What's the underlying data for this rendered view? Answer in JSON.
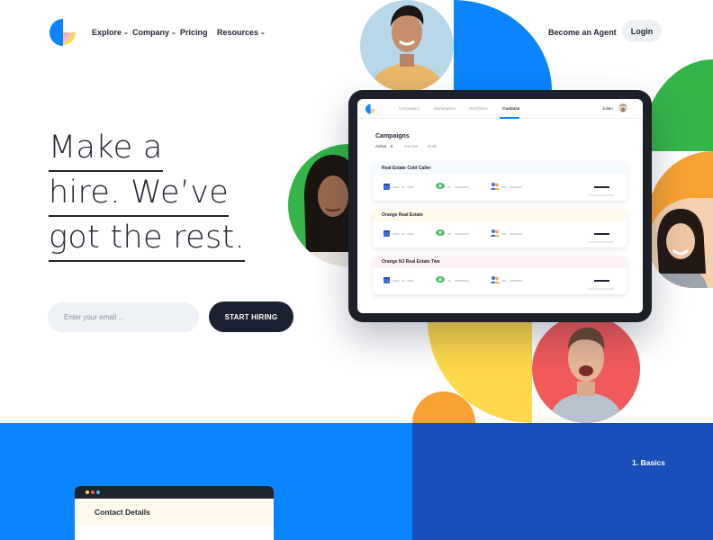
{
  "nav": {
    "items": [
      {
        "label": "Explore",
        "has_dropdown": true
      },
      {
        "label": "Company",
        "has_dropdown": true
      },
      {
        "label": "Pricing",
        "has_dropdown": false
      },
      {
        "label": "Resources",
        "has_dropdown": true
      }
    ],
    "become_agent": "Become an Agent",
    "login": "Login",
    "dropdown_glyph": "⌄"
  },
  "hero": {
    "lines": [
      "Make a",
      "hire. We’ve",
      "got the rest."
    ],
    "email_placeholder": "Enter your email ...",
    "cta": "START HIRING"
  },
  "dashboard": {
    "tabs": [
      "Campaigns",
      "Marketplace",
      "Workflows",
      "Contacts"
    ],
    "active_tab": "Contacts",
    "user": "Julian",
    "title": "Campaigns",
    "filters": [
      "Active",
      "Inactive",
      "Draft"
    ],
    "active_filter": "Active",
    "active_count": "X",
    "campaigns": [
      {
        "name": "Real Estate Cold Caller",
        "header_color": "#f4fbfd"
      },
      {
        "name": "Orange Real Estate",
        "header_color": "#fff9ea"
      },
      {
        "name": "Orange NJ Real Estate Two",
        "header_color": "#fdf1f3"
      }
    ]
  },
  "bottom": {
    "step": "1. Basics",
    "card_title": "Contact Details"
  },
  "colors": {
    "blue": "#0a84ff",
    "navy_blue": "#1a4fbb",
    "green": "#35b44a",
    "orange": "#f7a233",
    "yellow": "#fdd84a",
    "red": "#f15a5a",
    "dark": "#1b2130"
  },
  "icons": [
    "logo-icon",
    "chevron-down-icon",
    "calendar-icon",
    "eye-icon",
    "people-icon"
  ]
}
